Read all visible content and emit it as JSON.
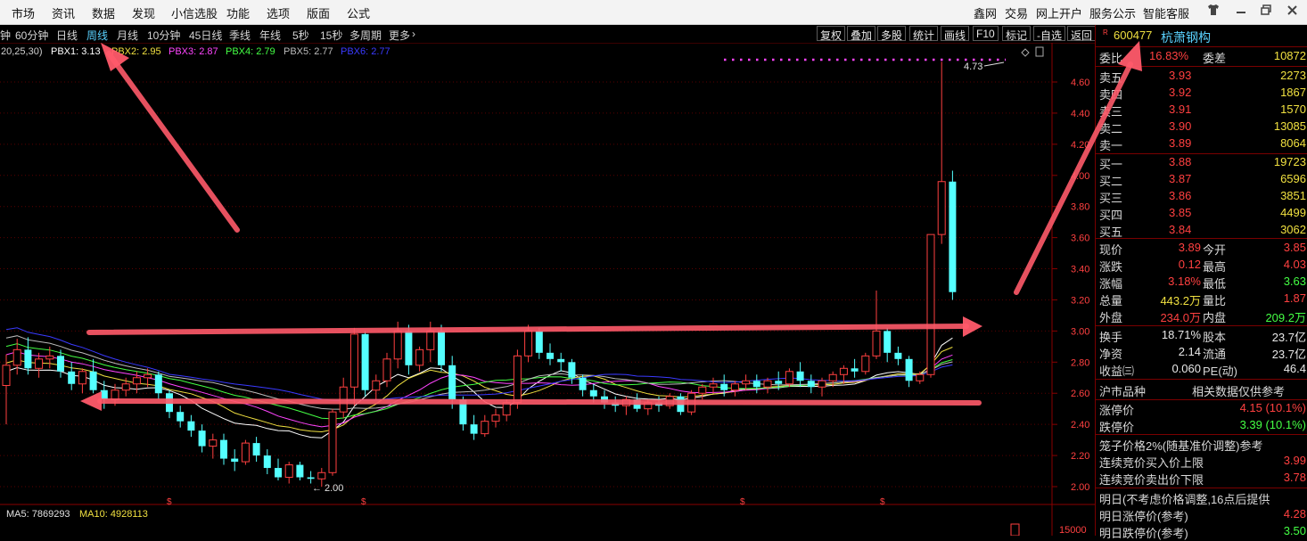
{
  "menu": {
    "left": [
      "市场",
      "资讯",
      "数据",
      "发现",
      "小信选股",
      "功能",
      "选项",
      "版面",
      "公式"
    ],
    "right": [
      "鑫网",
      "交易",
      "网上开户",
      "服务公示",
      "智能客服"
    ],
    "window_icons": [
      "shirt-icon",
      "minimize-icon",
      "restore-icon",
      "close-icon"
    ]
  },
  "periods": [
    "钟",
    "60分钟",
    "日线",
    "周线",
    "月线",
    "10分钟",
    "45日线",
    "季线",
    "年线",
    "5秒",
    "15秒",
    "多周期",
    "更多"
  ],
  "active_period": "周线",
  "right_tools": [
    "复权",
    "叠加",
    "多股",
    "统计",
    "画线",
    "F10",
    "标记",
    "-自选",
    "返回"
  ],
  "indicator_line": {
    "param": "20,25,30)",
    "items": [
      {
        "label": "PBX1: 3.13",
        "color": "#ffffff"
      },
      {
        "label": "PBX2: 2.95",
        "color": "#f0e040"
      },
      {
        "label": "PBX3: 2.87",
        "color": "#ff44ff"
      },
      {
        "label": "PBX4: 2.79",
        "color": "#44ff44"
      },
      {
        "label": "PBX5: 2.77",
        "color": "#bbbbbb"
      },
      {
        "label": "PBX6: 2.77",
        "color": "#3a3aff"
      }
    ]
  },
  "axis": {
    "ticks": [
      "4.60",
      "4.40",
      "4.20",
      "4.00",
      "3.80",
      "3.60",
      "3.40",
      "3.20",
      "3.00",
      "2.80",
      "2.60",
      "2.40",
      "2.20",
      "2.00"
    ],
    "vol_tick": "15000"
  },
  "annotations": {
    "high_label": "4.73",
    "low_label": "2.00"
  },
  "volume": {
    "ma5_label": "MA5: 7869293",
    "ma10_label": "MA10: 4928113"
  },
  "stock": {
    "code": "600477",
    "name": "杭萧钢构",
    "r_mark": "R"
  },
  "quote": {
    "weibi": {
      "label": "委比",
      "value": "16.83%",
      "label2": "委差",
      "value2": "10872"
    },
    "sell": [
      {
        "label": "卖五",
        "price": "3.93",
        "vol": "2273"
      },
      {
        "label": "卖四",
        "price": "3.92",
        "vol": "1867"
      },
      {
        "label": "卖三",
        "price": "3.91",
        "vol": "1570"
      },
      {
        "label": "卖二",
        "price": "3.90",
        "vol": "13085"
      },
      {
        "label": "卖一",
        "price": "3.89",
        "vol": "8064"
      }
    ],
    "buy": [
      {
        "label": "买一",
        "price": "3.88",
        "vol": "19723"
      },
      {
        "label": "买二",
        "price": "3.87",
        "vol": "6596"
      },
      {
        "label": "买三",
        "price": "3.86",
        "vol": "3851"
      },
      {
        "label": "买四",
        "price": "3.85",
        "vol": "4499"
      },
      {
        "label": "买五",
        "price": "3.84",
        "vol": "3062"
      }
    ],
    "stats1": [
      {
        "l": "现价",
        "v": "3.89",
        "c": "#ff4040",
        "l2": "今开",
        "v2": "3.85",
        "c2": "#ff4040"
      },
      {
        "l": "涨跌",
        "v": "0.12",
        "c": "#ff4040",
        "l2": "最高",
        "v2": "4.03",
        "c2": "#ff4040"
      },
      {
        "l": "涨幅",
        "v": "3.18%",
        "c": "#ff4040",
        "l2": "最低",
        "v2": "3.63",
        "c2": "#44ff44"
      },
      {
        "l": "总量",
        "v": "443.2万",
        "c": "#f0e040",
        "l2": "量比",
        "v2": "1.87",
        "c2": "#ff4040"
      },
      {
        "l": "外盘",
        "v": "234.0万",
        "c": "#ff4040",
        "l2": "内盘",
        "v2": "209.2万",
        "c2": "#44ff44"
      }
    ],
    "stats2": [
      {
        "l": "换手",
        "v": "18.71%",
        "l2": "股本",
        "v2": "23.7亿"
      },
      {
        "l": "净资",
        "v": "2.14",
        "l2": "流通",
        "v2": "23.7亿"
      },
      {
        "l": "收益㈢",
        "v": "0.060",
        "l2": "PE(动)",
        "v2": "46.4"
      }
    ],
    "market_type": {
      "label": "沪市品种",
      "note": "相关数据仅供参考"
    },
    "limits": [
      {
        "l": "涨停价",
        "v": "4.15 (10.1%)",
        "c": "#ff4040"
      },
      {
        "l": "跌停价",
        "v": "3.39 (10.1%)",
        "c": "#44ff44"
      }
    ],
    "cage_note": "笼子价格2%(随基准价调整)参考",
    "auction": [
      {
        "l": "连续竞价买入价上限",
        "v": "3.99",
        "c": "#ff4040"
      },
      {
        "l": "连续竞价卖出价下限",
        "v": "3.78",
        "c": "#ff4040"
      }
    ],
    "tomorrow_note": "明日(不考虑价格调整,16点后提供",
    "tomorrow": [
      {
        "l": "明日涨停价(参考)",
        "v": "4.28",
        "c": "#ff4040"
      },
      {
        "l": "明日跌停价(参考)",
        "v": "3.50",
        "c": "#44ff44"
      }
    ]
  },
  "chart_data": {
    "type": "candlestick",
    "y_range": [
      1.93,
      4.76
    ],
    "candles": [
      [
        2.65,
        2.85,
        2.4,
        2.78
      ],
      [
        2.78,
        2.95,
        2.72,
        2.88
      ],
      [
        2.88,
        2.96,
        2.72,
        2.76
      ],
      [
        2.76,
        2.86,
        2.7,
        2.82
      ],
      [
        2.82,
        2.9,
        2.76,
        2.84
      ],
      [
        2.84,
        2.88,
        2.7,
        2.74
      ],
      [
        2.74,
        2.8,
        2.62,
        2.66
      ],
      [
        2.66,
        2.76,
        2.6,
        2.74
      ],
      [
        2.74,
        2.82,
        2.6,
        2.62
      ],
      [
        2.62,
        2.68,
        2.5,
        2.56
      ],
      [
        2.56,
        2.66,
        2.52,
        2.62
      ],
      [
        2.62,
        2.7,
        2.58,
        2.66
      ],
      [
        2.66,
        2.74,
        2.6,
        2.7
      ],
      [
        2.7,
        2.76,
        2.64,
        2.72
      ],
      [
        2.72,
        2.74,
        2.56,
        2.6
      ],
      [
        2.6,
        2.62,
        2.44,
        2.48
      ],
      [
        2.48,
        2.52,
        2.38,
        2.42
      ],
      [
        2.42,
        2.46,
        2.32,
        2.36
      ],
      [
        2.36,
        2.4,
        2.22,
        2.26
      ],
      [
        2.26,
        2.34,
        2.18,
        2.3
      ],
      [
        2.3,
        2.34,
        2.14,
        2.18
      ],
      [
        2.18,
        2.24,
        2.1,
        2.16
      ],
      [
        2.16,
        2.3,
        2.14,
        2.28
      ],
      [
        2.28,
        2.32,
        2.16,
        2.2
      ],
      [
        2.2,
        2.24,
        2.08,
        2.12
      ],
      [
        2.12,
        2.18,
        2.04,
        2.06
      ],
      [
        2.06,
        2.16,
        2.02,
        2.14
      ],
      [
        2.14,
        2.16,
        2.04,
        2.06
      ],
      [
        2.06,
        2.1,
        2.02,
        2.05
      ],
      [
        2.05,
        2.12,
        2.0,
        2.09
      ],
      [
        2.09,
        2.5,
        2.07,
        2.48
      ],
      [
        2.48,
        2.7,
        2.44,
        2.64
      ],
      [
        2.64,
        3.02,
        2.52,
        2.98
      ],
      [
        2.98,
        3.0,
        2.58,
        2.62
      ],
      [
        2.62,
        2.72,
        2.56,
        2.68
      ],
      [
        2.68,
        2.86,
        2.64,
        2.82
      ],
      [
        2.82,
        3.06,
        2.76,
        3.0
      ],
      [
        3.0,
        3.04,
        2.72,
        2.78
      ],
      [
        2.78,
        2.9,
        2.74,
        2.88
      ],
      [
        2.88,
        3.06,
        2.8,
        3.0
      ],
      [
        3.0,
        3.04,
        2.74,
        2.78
      ],
      [
        2.78,
        2.84,
        2.5,
        2.56
      ],
      [
        2.56,
        2.58,
        2.36,
        2.4
      ],
      [
        2.4,
        2.46,
        2.3,
        2.34
      ],
      [
        2.34,
        2.46,
        2.32,
        2.42
      ],
      [
        2.42,
        2.5,
        2.38,
        2.46
      ],
      [
        2.46,
        2.56,
        2.42,
        2.54
      ],
      [
        2.54,
        2.88,
        2.5,
        2.84
      ],
      [
        2.84,
        3.04,
        2.8,
        3.0
      ],
      [
        3.0,
        3.02,
        2.82,
        2.86
      ],
      [
        2.86,
        2.92,
        2.78,
        2.82
      ],
      [
        2.82,
        2.86,
        2.74,
        2.8
      ],
      [
        2.8,
        2.82,
        2.66,
        2.7
      ],
      [
        2.7,
        2.72,
        2.58,
        2.62
      ],
      [
        2.62,
        2.66,
        2.54,
        2.58
      ],
      [
        2.58,
        2.62,
        2.5,
        2.54
      ],
      [
        2.54,
        2.58,
        2.48,
        2.52
      ],
      [
        2.52,
        2.58,
        2.46,
        2.56
      ],
      [
        2.56,
        2.6,
        2.48,
        2.5
      ],
      [
        2.5,
        2.56,
        2.46,
        2.54
      ],
      [
        2.54,
        2.58,
        2.48,
        2.52
      ],
      [
        2.52,
        2.6,
        2.5,
        2.58
      ],
      [
        2.58,
        2.6,
        2.46,
        2.48
      ],
      [
        2.48,
        2.62,
        2.46,
        2.6
      ],
      [
        2.6,
        2.66,
        2.56,
        2.64
      ],
      [
        2.64,
        2.7,
        2.6,
        2.66
      ],
      [
        2.66,
        2.72,
        2.58,
        2.62
      ],
      [
        2.62,
        2.68,
        2.58,
        2.66
      ],
      [
        2.66,
        2.72,
        2.62,
        2.68
      ],
      [
        2.68,
        2.72,
        2.6,
        2.64
      ],
      [
        2.64,
        2.7,
        2.6,
        2.68
      ],
      [
        2.68,
        2.74,
        2.62,
        2.66
      ],
      [
        2.66,
        2.76,
        2.64,
        2.74
      ],
      [
        2.74,
        2.8,
        2.64,
        2.68
      ],
      [
        2.68,
        2.72,
        2.6,
        2.64
      ],
      [
        2.64,
        2.7,
        2.58,
        2.68
      ],
      [
        2.68,
        2.74,
        2.64,
        2.72
      ],
      [
        2.72,
        2.78,
        2.66,
        2.76
      ],
      [
        2.76,
        2.82,
        2.7,
        2.74
      ],
      [
        2.74,
        2.86,
        2.72,
        2.84
      ],
      [
        2.84,
        3.26,
        2.82,
        3.0
      ],
      [
        3.0,
        3.02,
        2.8,
        2.86
      ],
      [
        2.86,
        2.9,
        2.78,
        2.82
      ],
      [
        2.82,
        2.84,
        2.64,
        2.68
      ],
      [
        2.68,
        2.74,
        2.66,
        2.72
      ],
      [
        2.72,
        3.1,
        2.7,
        3.62
      ],
      [
        3.62,
        4.73,
        3.56,
        3.96
      ],
      [
        3.96,
        4.03,
        3.2,
        3.25
      ]
    ],
    "series": [
      {
        "name": "PBX1",
        "color": "#ffffff"
      },
      {
        "name": "PBX2",
        "color": "#f0e040"
      },
      {
        "name": "PBX3",
        "color": "#ff44ff"
      },
      {
        "name": "PBX4",
        "color": "#44ff44"
      },
      {
        "name": "PBX5",
        "color": "#bbbbbb"
      },
      {
        "name": "PBX6",
        "color": "#3a3aff"
      }
    ]
  }
}
